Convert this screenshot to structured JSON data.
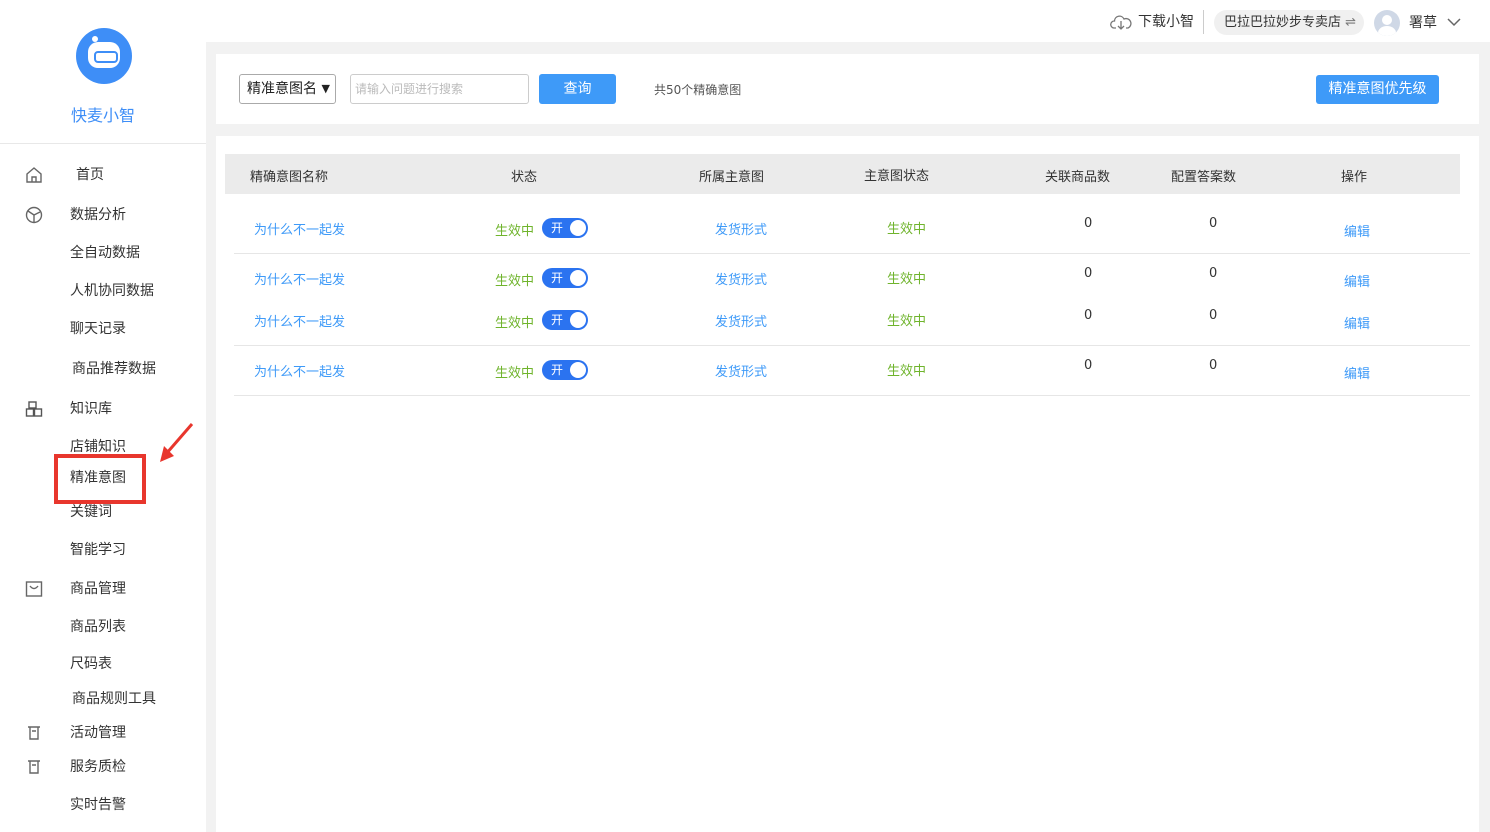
{
  "app": {
    "name": "快麦小智"
  },
  "header": {
    "download_label": "下载小智",
    "store_name": "巴拉巴拉妙步专卖店",
    "swap_glyph": "⇌",
    "username": "署草"
  },
  "sidebar": {
    "items": [
      {
        "label": "首页",
        "icon": "home-icon"
      },
      {
        "label": "数据分析",
        "icon": "chart-icon"
      },
      {
        "label": "全自动数据"
      },
      {
        "label": "人机协同数据"
      },
      {
        "label": "聊天记录"
      },
      {
        "label": "商品推荐数据"
      },
      {
        "label": "知识库",
        "icon": "knowledge-icon"
      },
      {
        "label": "店铺知识"
      },
      {
        "label": "精准意图"
      },
      {
        "label": "关键词"
      },
      {
        "label": "智能学习"
      },
      {
        "label": "商品管理",
        "icon": "bag-icon"
      },
      {
        "label": "商品列表"
      },
      {
        "label": "尺码表"
      },
      {
        "label": "商品规则工具"
      },
      {
        "label": "活动管理",
        "icon": "activity-icon"
      },
      {
        "label": "服务质检",
        "icon": "inspection-icon"
      },
      {
        "label": "实时告警"
      }
    ],
    "highlight_color": "#e8362d"
  },
  "filter": {
    "select_value": "精准意图名",
    "search_placeholder": "请输入问题进行搜索",
    "query_label": "查询",
    "count_text": "共50个精确意图",
    "priority_label": "精准意图优先级"
  },
  "table": {
    "headers": [
      "精确意图名称",
      "状态",
      "所属主意图",
      "主意图状态",
      "关联商品数",
      "配置答案数",
      "操作"
    ],
    "rows": [
      {
        "name": "为什么不一起发",
        "status": "生效中",
        "toggle": "开",
        "main_intent": "发货形式",
        "main_status": "生效中",
        "products": "0",
        "answers": "0",
        "action": "编辑"
      },
      {
        "name": "为什么不一起发",
        "status": "生效中",
        "toggle": "开",
        "main_intent": "发货形式",
        "main_status": "生效中",
        "products": "0",
        "answers": "0",
        "action": "编辑"
      },
      {
        "name": "为什么不一起发",
        "status": "生效中",
        "toggle": "开",
        "main_intent": "发货形式",
        "main_status": "生效中",
        "products": "0",
        "answers": "0",
        "action": "编辑"
      },
      {
        "name": "为什么不一起发",
        "status": "生效中",
        "toggle": "开",
        "main_intent": "发货形式",
        "main_status": "生效中",
        "products": "0",
        "answers": "0",
        "action": "编辑"
      }
    ]
  },
  "colors": {
    "accent": "#3e9af8",
    "toggle": "#2b73f0",
    "status_green": "#6fb42c",
    "brand": "#3e8ef7"
  }
}
